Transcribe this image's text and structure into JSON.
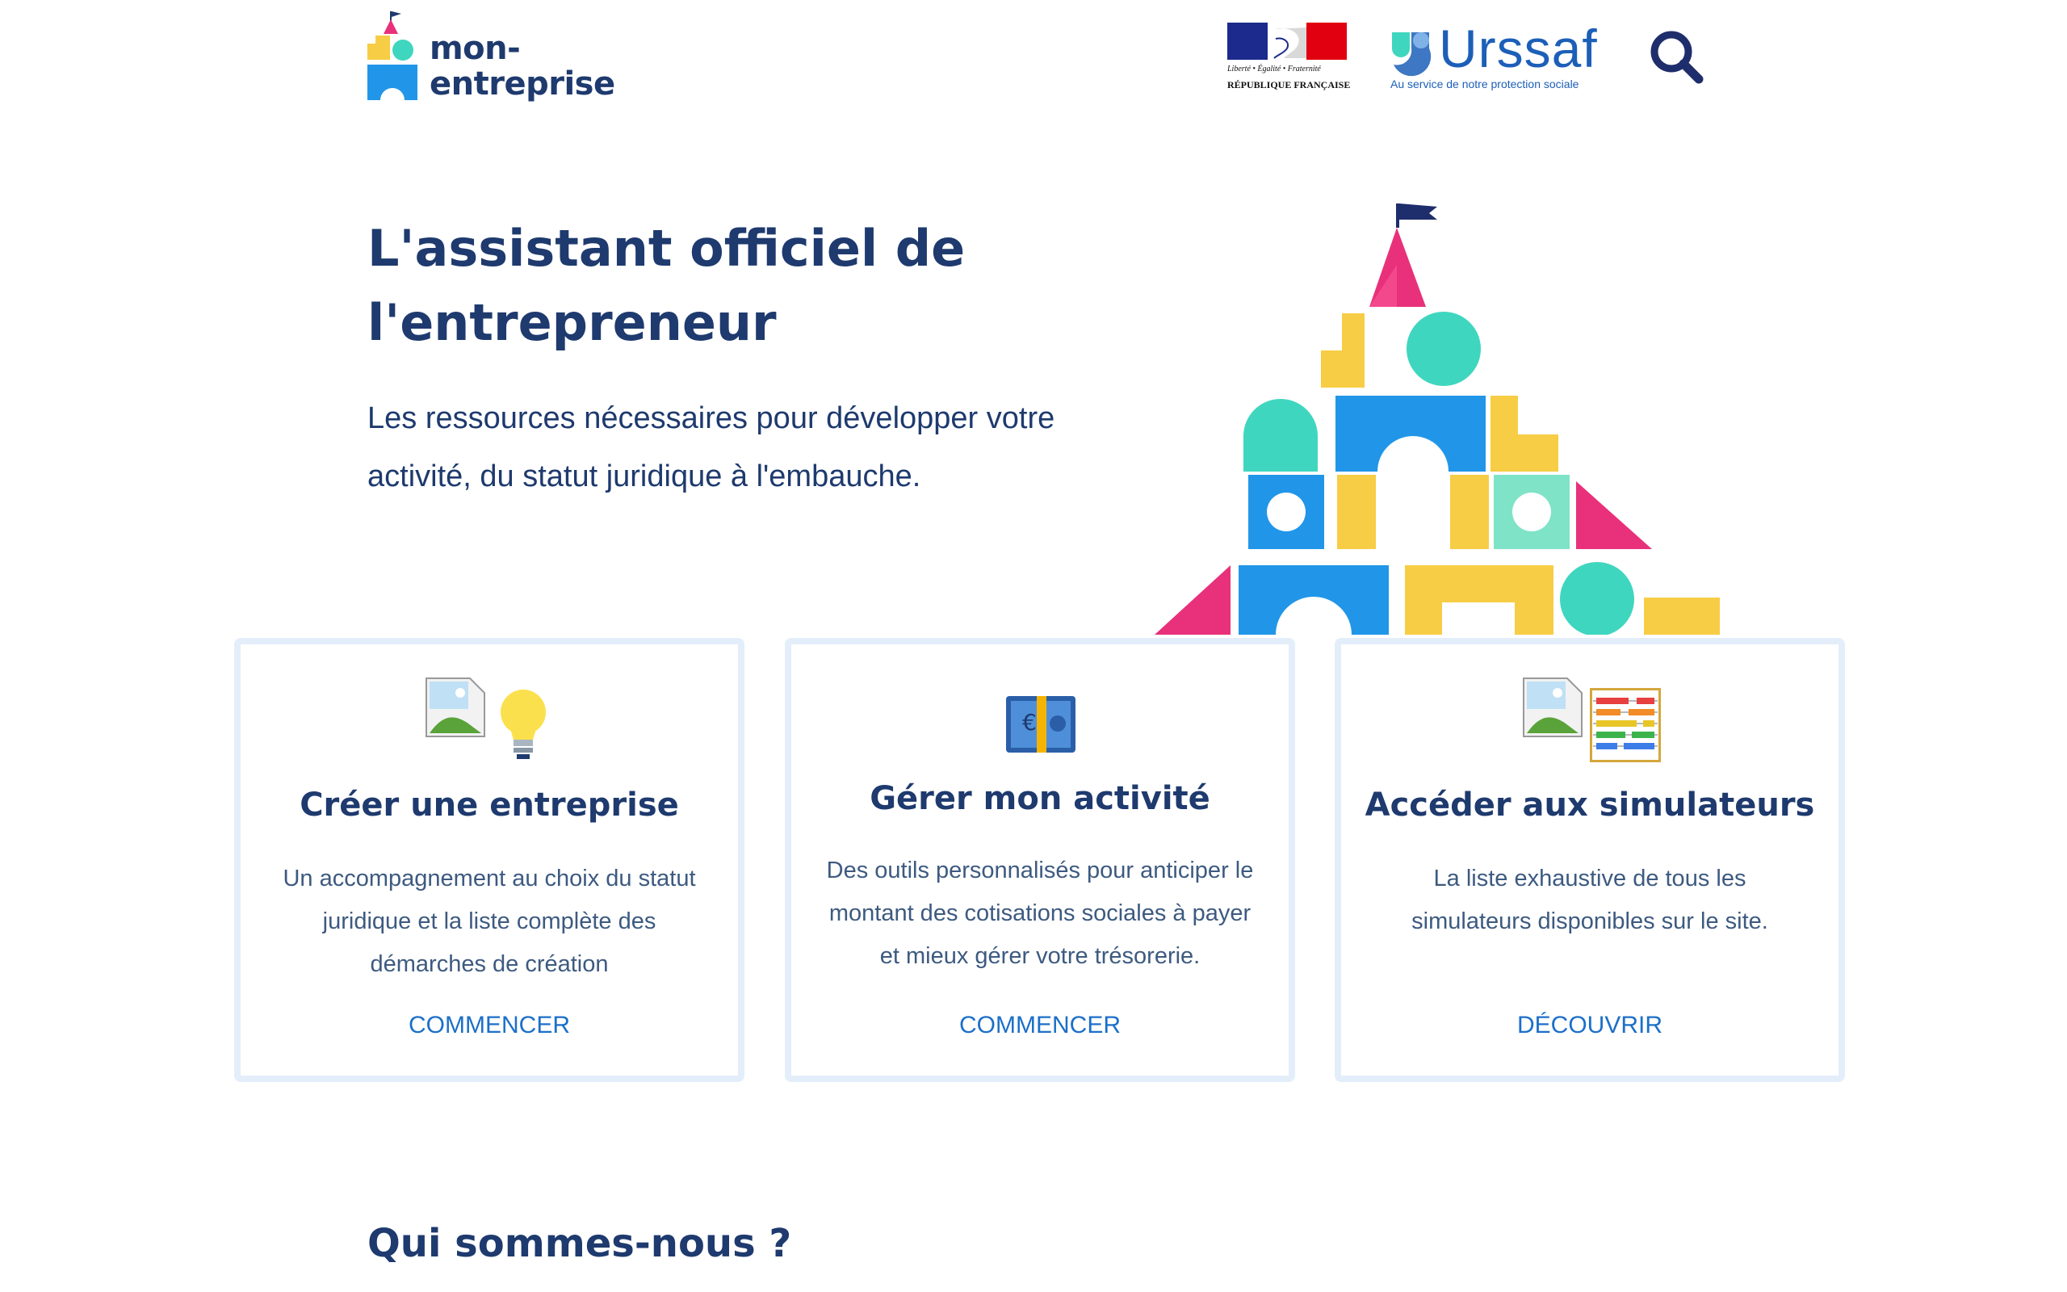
{
  "header": {
    "logo_text_line1": "mon-",
    "logo_text_line2": "entreprise",
    "marianne_line1": "Liberté • Égalité • Fraternité",
    "marianne_line2": "RÉPUBLIQUE FRANÇAISE",
    "urssaf_name": "Urssaf",
    "urssaf_tagline": "Au service de notre protection sociale",
    "search_icon": "search-icon"
  },
  "hero": {
    "title": "L'assistant officiel de l'entrepreneur",
    "subtitle": "Les ressources nécessaires pour développer votre activité, du statut juridique à l'embauche."
  },
  "cards": [
    {
      "icons": [
        "broken-image-icon",
        "lightbulb-icon"
      ],
      "title": "Créer une entreprise",
      "description": "Un accompagnement au choix du statut juridique et la liste complète des démarches de création",
      "cta": "COMMENCER"
    },
    {
      "icons": [
        "euro-banknote-icon"
      ],
      "title": "Gérer mon activité",
      "description": "Des outils personnalisés pour anticiper le montant des cotisations sociales à payer et mieux gérer votre trésorerie.",
      "cta": "COMMENCER"
    },
    {
      "icons": [
        "broken-image-icon",
        "abacus-icon"
      ],
      "title": "Accéder aux simulateurs",
      "description": "La liste exhaustive de tous les simulateurs disponibles sur le site.",
      "cta": "DÉCOUVRIR"
    }
  ],
  "about": {
    "title": "Qui sommes-nous ?"
  },
  "colors": {
    "primary": "#1e3a6e",
    "link": "#1c6fc8",
    "card_border": "#e3eefa",
    "pink": "#e8317a",
    "yellow": "#f7cd45",
    "blue": "#2196e8",
    "teal": "#3fd6bf"
  }
}
